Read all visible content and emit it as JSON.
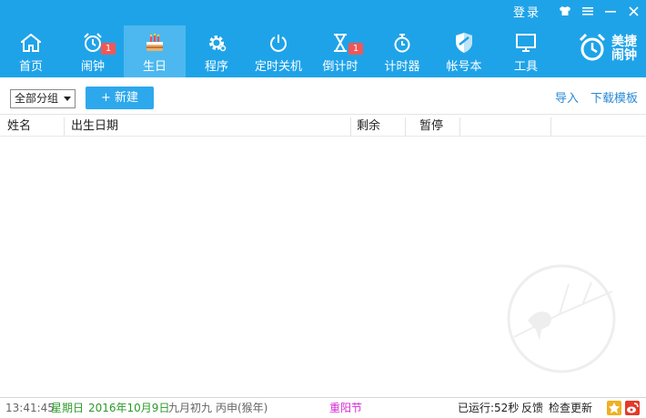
{
  "titlebar": {
    "login": "登录",
    "skin_icon": "shirt-icon",
    "menu_icon": "menu-icon",
    "minimize_icon": "minimize-icon",
    "close_icon": "close-icon"
  },
  "nav": {
    "items": [
      {
        "label": "首页",
        "icon": "home-icon",
        "badge": ""
      },
      {
        "label": "闹钟",
        "icon": "alarm-clock-icon",
        "badge": "1"
      },
      {
        "label": "生日",
        "icon": "birthday-cake-icon",
        "badge": ""
      },
      {
        "label": "程序",
        "icon": "gear-icon",
        "badge": ""
      },
      {
        "label": "定时关机",
        "icon": "power-icon",
        "badge": ""
      },
      {
        "label": "倒计时",
        "icon": "hourglass-icon",
        "badge": "1"
      },
      {
        "label": "计时器",
        "icon": "stopwatch-icon",
        "badge": ""
      },
      {
        "label": "帐号本",
        "icon": "shield-icon",
        "badge": ""
      },
      {
        "label": "工具",
        "icon": "monitor-icon",
        "badge": ""
      }
    ],
    "active": "生日"
  },
  "brand": {
    "line1": "美捷",
    "line2": "闹钟"
  },
  "toolbar": {
    "group_value": "全部分组",
    "new_label": "+ 新建",
    "import_label": "导入",
    "template_label": "下载模板"
  },
  "table": {
    "columns": [
      "姓名",
      "出生日期",
      "剩余",
      "暂停"
    ],
    "rows": []
  },
  "status": {
    "time": "13:41:45",
    "weekday": "星期日",
    "date": "2016年10月9日",
    "lunar": "九月初九",
    "ganzhi": "丙申(猴年)",
    "festival": "重阳节",
    "uptime": "已运行:52秒",
    "feedback": "反馈",
    "check_update": "检查更新"
  },
  "colors": {
    "header": "#1fa3e8",
    "active_tab": "#4db8ef",
    "badge": "#f25757",
    "link": "#2a8ad6",
    "weekday": "#2a9a2a",
    "festival": "#d42ad4"
  }
}
